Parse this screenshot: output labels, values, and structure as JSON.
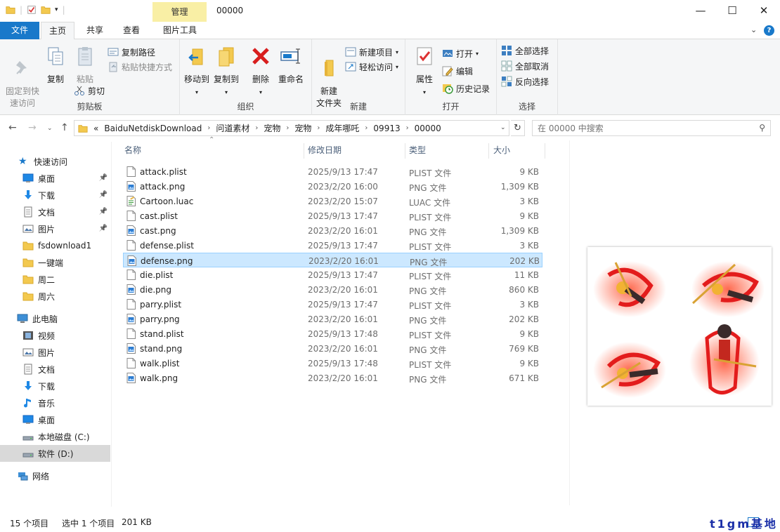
{
  "window": {
    "title": "00000",
    "context_tab": "管理",
    "buttons": {
      "minimize": "—",
      "maximize": "☐",
      "close": "✕"
    }
  },
  "tabs": {
    "file": "文件",
    "home": "主页",
    "share": "共享",
    "view": "查看",
    "picture_tools": "图片工具"
  },
  "ribbon": {
    "clipboard": {
      "label": "剪贴板",
      "pin": "固定到快\n速访问",
      "copy": "复制",
      "paste": "粘贴",
      "copy_path": "复制路径",
      "paste_shortcut": "粘贴快捷方式",
      "cut": "剪切"
    },
    "organize": {
      "label": "组织",
      "move_to": "移动到",
      "copy_to": "复制到",
      "delete": "删除",
      "rename": "重命名"
    },
    "new": {
      "label": "新建",
      "new_folder": "新建\n文件夹",
      "new_item": "新建项目",
      "easy_access": "轻松访问"
    },
    "open": {
      "label": "打开",
      "properties": "属性",
      "open": "打开",
      "edit": "编辑",
      "history": "历史记录"
    },
    "select": {
      "label": "选择",
      "select_all": "全部选择",
      "select_none": "全部取消",
      "invert": "反向选择"
    }
  },
  "address": {
    "prefix": "«",
    "crumbs": [
      "BaiduNetdiskDownload",
      "问道素材",
      "宠物",
      "宠物",
      "成年哪吒",
      "09913",
      "00000"
    ]
  },
  "search": {
    "placeholder": "在 00000 中搜索"
  },
  "nav": {
    "quick_access": "快速访问",
    "quick_items": [
      {
        "label": "桌面",
        "icon": "desktop-icon",
        "pinned": true
      },
      {
        "label": "下载",
        "icon": "download-icon",
        "pinned": true
      },
      {
        "label": "文档",
        "icon": "document-icon",
        "pinned": true
      },
      {
        "label": "图片",
        "icon": "picture-icon",
        "pinned": true
      },
      {
        "label": "fsdownload1",
        "icon": "folder-icon",
        "pinned": false
      },
      {
        "label": "一键端",
        "icon": "folder-icon",
        "pinned": false
      },
      {
        "label": "周二",
        "icon": "folder-icon",
        "pinned": false
      },
      {
        "label": "周六",
        "icon": "folder-icon",
        "pinned": false
      }
    ],
    "this_pc": "此电脑",
    "pc_items": [
      {
        "label": "视频",
        "icon": "video-icon"
      },
      {
        "label": "图片",
        "icon": "picture-icon"
      },
      {
        "label": "文档",
        "icon": "document-icon"
      },
      {
        "label": "下载",
        "icon": "download-icon"
      },
      {
        "label": "音乐",
        "icon": "music-icon"
      },
      {
        "label": "桌面",
        "icon": "desktop-icon"
      },
      {
        "label": "本地磁盘 (C:)",
        "icon": "drive-icon"
      },
      {
        "label": "软件 (D:)",
        "icon": "drive-icon"
      }
    ],
    "network": "网络"
  },
  "columns": {
    "name": "名称",
    "date": "修改日期",
    "type": "类型",
    "size": "大小"
  },
  "files": [
    {
      "name": "attack.plist",
      "date": "2025/9/13 17:47",
      "type": "PLIST 文件",
      "size": "9 KB",
      "kind": "plist"
    },
    {
      "name": "attack.png",
      "date": "2023/2/20 16:00",
      "type": "PNG 文件",
      "size": "1,309 KB",
      "kind": "png"
    },
    {
      "name": "Cartoon.luac",
      "date": "2023/2/20 15:07",
      "type": "LUAC 文件",
      "size": "3 KB",
      "kind": "luac"
    },
    {
      "name": "cast.plist",
      "date": "2025/9/13 17:47",
      "type": "PLIST 文件",
      "size": "9 KB",
      "kind": "plist"
    },
    {
      "name": "cast.png",
      "date": "2023/2/20 16:01",
      "type": "PNG 文件",
      "size": "1,309 KB",
      "kind": "png"
    },
    {
      "name": "defense.plist",
      "date": "2025/9/13 17:47",
      "type": "PLIST 文件",
      "size": "3 KB",
      "kind": "plist"
    },
    {
      "name": "defense.png",
      "date": "2023/2/20 16:01",
      "type": "PNG 文件",
      "size": "202 KB",
      "kind": "png",
      "selected": true
    },
    {
      "name": "die.plist",
      "date": "2025/9/13 17:47",
      "type": "PLIST 文件",
      "size": "11 KB",
      "kind": "plist"
    },
    {
      "name": "die.png",
      "date": "2023/2/20 16:01",
      "type": "PNG 文件",
      "size": "860 KB",
      "kind": "png"
    },
    {
      "name": "parry.plist",
      "date": "2025/9/13 17:47",
      "type": "PLIST 文件",
      "size": "3 KB",
      "kind": "plist"
    },
    {
      "name": "parry.png",
      "date": "2023/2/20 16:01",
      "type": "PNG 文件",
      "size": "202 KB",
      "kind": "png"
    },
    {
      "name": "stand.plist",
      "date": "2025/9/13 17:48",
      "type": "PLIST 文件",
      "size": "9 KB",
      "kind": "plist"
    },
    {
      "name": "stand.png",
      "date": "2023/2/20 16:01",
      "type": "PNG 文件",
      "size": "769 KB",
      "kind": "png"
    },
    {
      "name": "walk.plist",
      "date": "2025/9/13 17:48",
      "type": "PLIST 文件",
      "size": "9 KB",
      "kind": "plist"
    },
    {
      "name": "walk.png",
      "date": "2023/2/20 16:01",
      "type": "PNG 文件",
      "size": "671 KB",
      "kind": "png"
    }
  ],
  "status": {
    "count": "15 个项目",
    "selected": "选中 1 个项目",
    "size": "201 KB"
  },
  "watermark": "t1gm基地",
  "colors": {
    "accent": "#1979ca",
    "selection": "#cce8ff",
    "selection_border": "#99d1ff",
    "context_tab": "#f9efa5"
  }
}
